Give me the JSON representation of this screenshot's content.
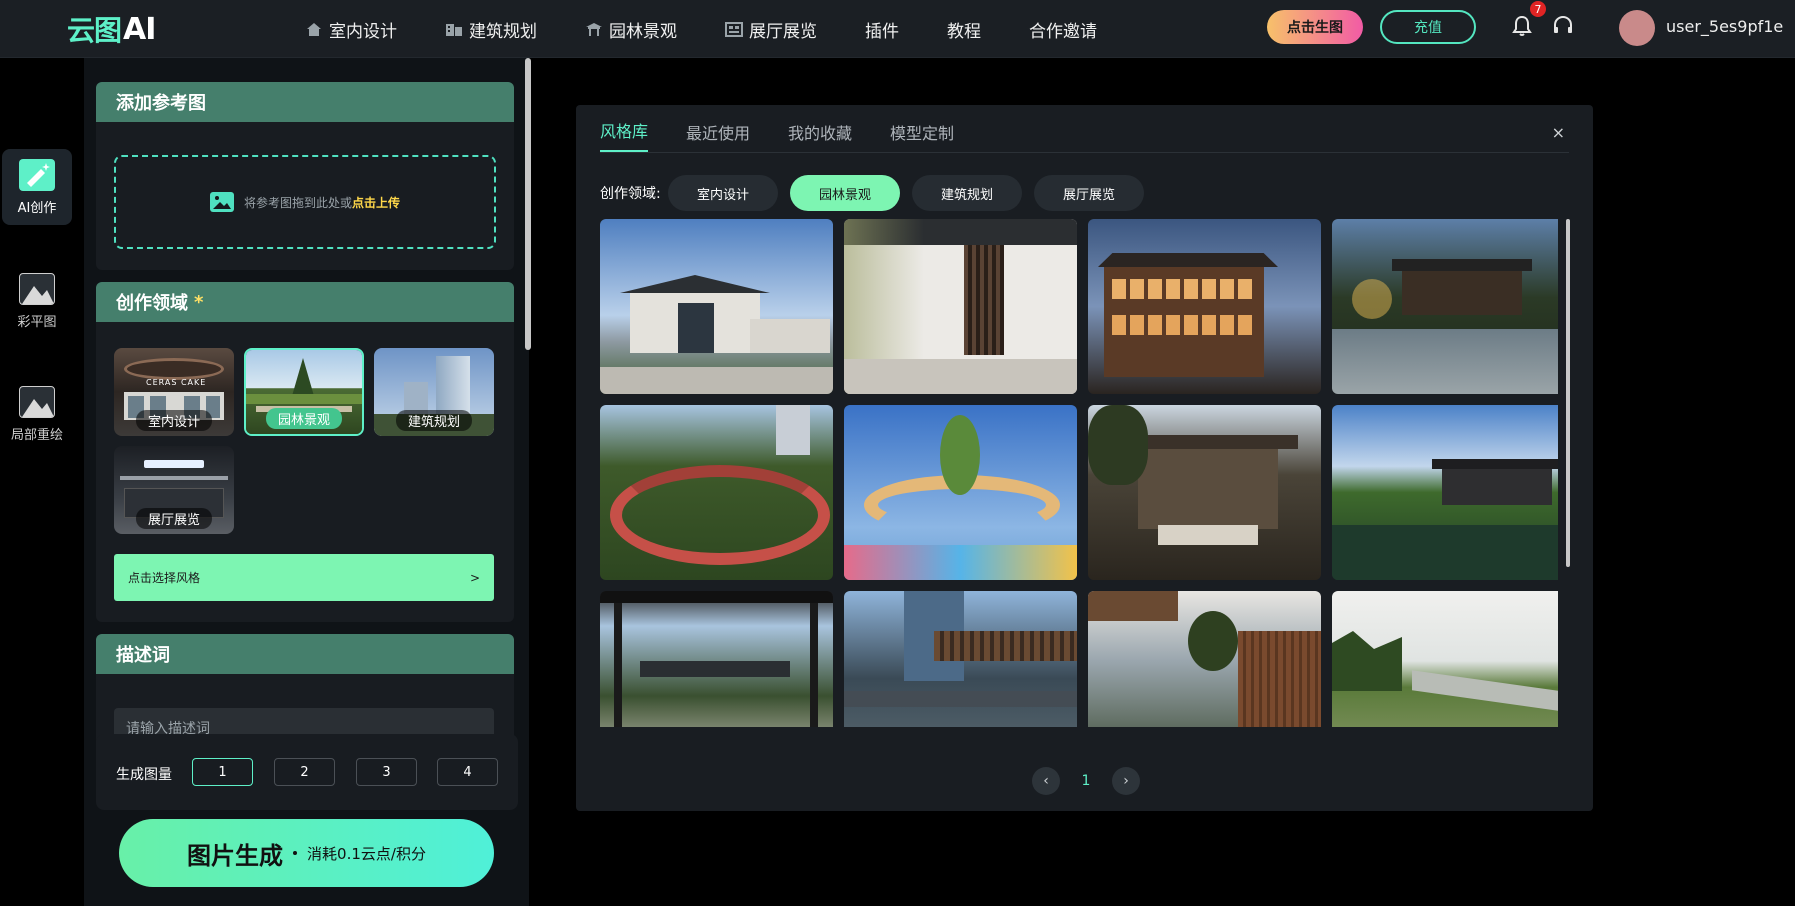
{
  "app": {
    "logo_prefix": "云图",
    "logo_suffix": "AI"
  },
  "nav": [
    {
      "label": "室内设计",
      "icon": "home-icon"
    },
    {
      "label": "建筑规划",
      "icon": "building-icon"
    },
    {
      "label": "园林景观",
      "icon": "pavilion-icon"
    },
    {
      "label": "展厅展览",
      "icon": "exhibition-icon"
    },
    {
      "label": "插件",
      "icon": ""
    },
    {
      "label": "教程",
      "icon": ""
    },
    {
      "label": "合作邀请",
      "icon": ""
    }
  ],
  "header": {
    "generate_label": "点击生图",
    "charge_label": "充值",
    "notification_count": "7",
    "username": "user_5es9pf1e"
  },
  "rail": [
    {
      "label": "AI创作",
      "icon": "ai-create-icon",
      "active": true
    },
    {
      "label": "彩平图",
      "icon": "color-plan-icon",
      "active": false
    },
    {
      "label": "局部重绘",
      "icon": "inpaint-icon",
      "active": false
    }
  ],
  "reference": {
    "title": "添加参考图",
    "drop_text": "将参考图拖到此处或",
    "upload_link": "点击上传"
  },
  "domain": {
    "title": "创作领域",
    "required_mark": "*",
    "options": [
      {
        "label": "室内设计",
        "selected": false
      },
      {
        "label": "园林景观",
        "selected": true
      },
      {
        "label": "建筑规划",
        "selected": false
      },
      {
        "label": "展厅展览",
        "selected": false
      }
    ],
    "thumb_sign_text": "CERAS CAKE",
    "style_button": "点击选择风格",
    "style_button_arrow": ">"
  },
  "description": {
    "title": "描述词",
    "placeholder": "请输入描述词"
  },
  "count": {
    "label": "生成图量",
    "options": [
      "1",
      "2",
      "3",
      "4"
    ],
    "selected": "1"
  },
  "generate": {
    "label": "图片生成",
    "cost": "消耗0.1云点/积分"
  },
  "modal": {
    "tabs": [
      {
        "label": "风格库",
        "active": true
      },
      {
        "label": "最近使用",
        "active": false
      },
      {
        "label": "我的收藏",
        "active": false
      },
      {
        "label": "模型定制",
        "active": false
      }
    ],
    "close": "×",
    "filter_label": "创作领域:",
    "filters": [
      {
        "label": "室内设计",
        "selected": false
      },
      {
        "label": "园林景观",
        "selected": true
      },
      {
        "label": "建筑规划",
        "selected": false
      },
      {
        "label": "展厅展览",
        "selected": false
      }
    ],
    "images": [
      "modern-chinese-entrance",
      "white-wall-courtyard-tree",
      "wooden-pagoda-house-dusk",
      "night-garden-pond-pavilion",
      "red-walkway-loop-bridge",
      "rainbow-arch-playground",
      "pine-tree-terrace-lounge",
      "lake-pavilion-garden",
      "courtyard-gate-pines",
      "steel-canopy-plaza",
      "wood-courtyard-pine",
      "linear-park-path"
    ],
    "pager": {
      "prev": "‹",
      "current": "1",
      "next": "›"
    }
  },
  "colors": {
    "accent": "#5ef0c8",
    "panel_header": "#457f6c",
    "button_green": "#7df5b2",
    "gen_gradient_start": "#f7c16a",
    "gen_gradient_end": "#f25ba5"
  }
}
